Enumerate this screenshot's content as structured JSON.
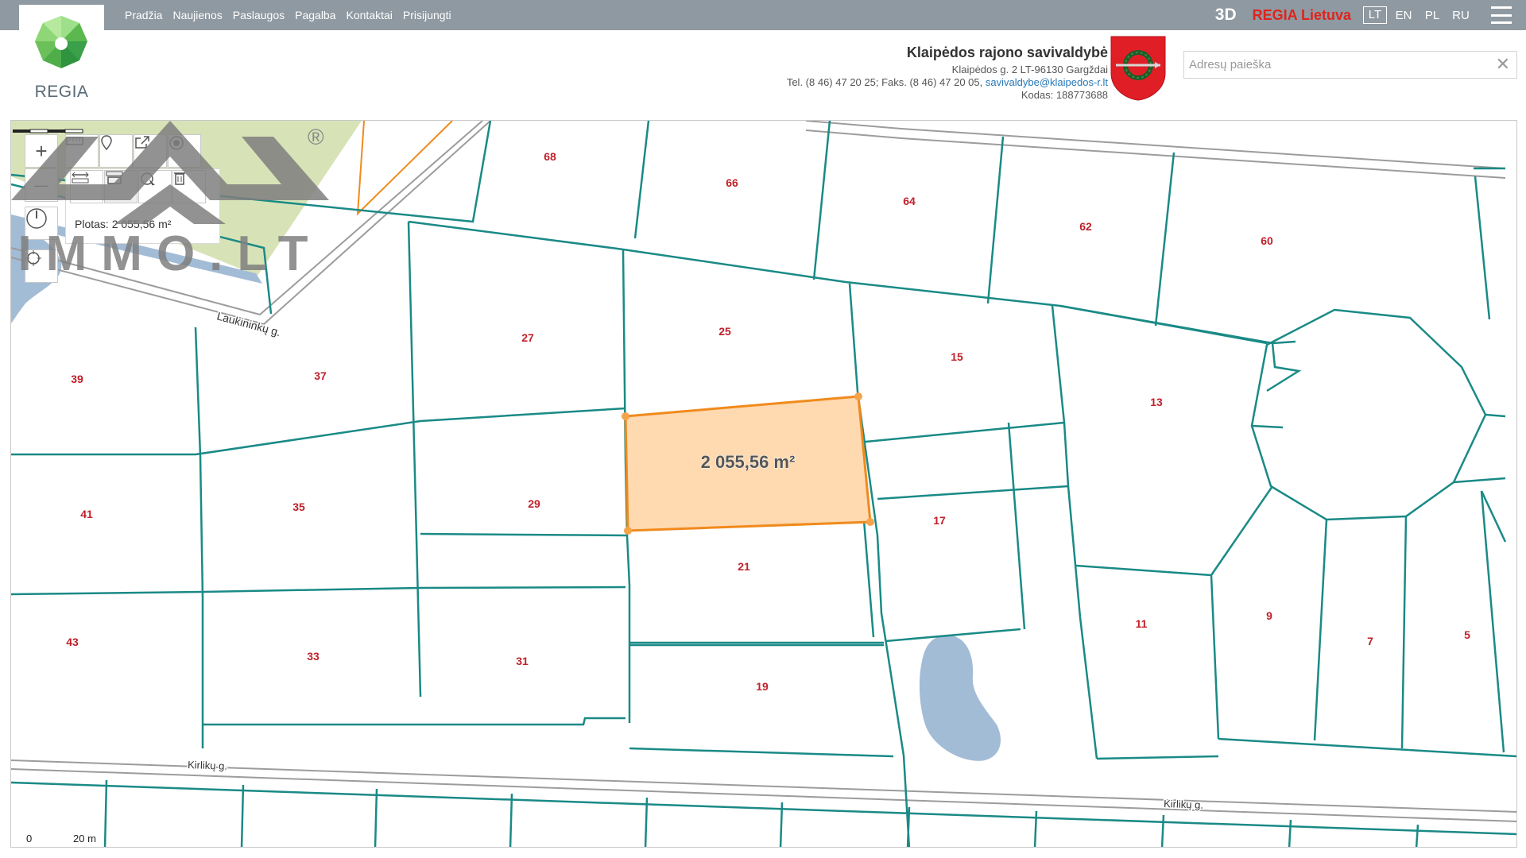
{
  "topbar": {
    "nav": [
      "Pradžia",
      "Naujienos",
      "Paslaugos",
      "Pagalba",
      "Kontaktai",
      "Prisijungti"
    ],
    "btn_3d": "3D",
    "regia_lietuva": "REGIA Lietuva",
    "languages": [
      "LT",
      "EN",
      "PL",
      "RU"
    ],
    "active_language": "LT"
  },
  "logo": {
    "text": "REGIA"
  },
  "municipality": {
    "name": "Klaipėdos rajono savivaldybė",
    "address": "Klaipėdos g. 2 LT-96130 Gargždai",
    "phone": "Tel. (8 46) 47 20 25; Faks. (8 46) 47 20 05,",
    "email": "savivaldybe@klaipedos-r.lt",
    "code": "Kodas: 188773688"
  },
  "search": {
    "placeholder": "Adresų paieška",
    "value": "",
    "clear": "✕"
  },
  "map": {
    "area_label": "Plotas: 2 055,56 m²",
    "selected_area": "2 055,56 m²",
    "streets": [
      "Laukininkų g.",
      "Kirlikų g.",
      "Kirlikų g."
    ],
    "parcel_numbers": [
      "68",
      "66",
      "64",
      "62",
      "60",
      "27",
      "25",
      "15",
      "13",
      "39",
      "37",
      "29",
      "17",
      "41",
      "35",
      "21",
      "11",
      "9",
      "7",
      "5",
      "43",
      "33",
      "31",
      "19"
    ],
    "scale": {
      "zero": "0",
      "distance": "20 m"
    },
    "colors": {
      "boundary": "#1a8a86",
      "selection_fill": "#ffd9b0",
      "selection_stroke": "#f08a1c",
      "parcel_label": "#c0202a",
      "water": "#a3bcd6",
      "field": "#d7e3b7"
    }
  },
  "toolbar": {
    "zoom_in": "+",
    "zoom_out": "—",
    "icons": [
      "ruler-icon",
      "pin-icon",
      "share-icon",
      "target-icon",
      "measure-distance-icon",
      "measure-area-icon",
      "select-area-icon",
      "trash-icon",
      "compass-icon",
      "locate-icon"
    ]
  },
  "watermark": {
    "text": "IMMO.LT",
    "registered": "®"
  }
}
